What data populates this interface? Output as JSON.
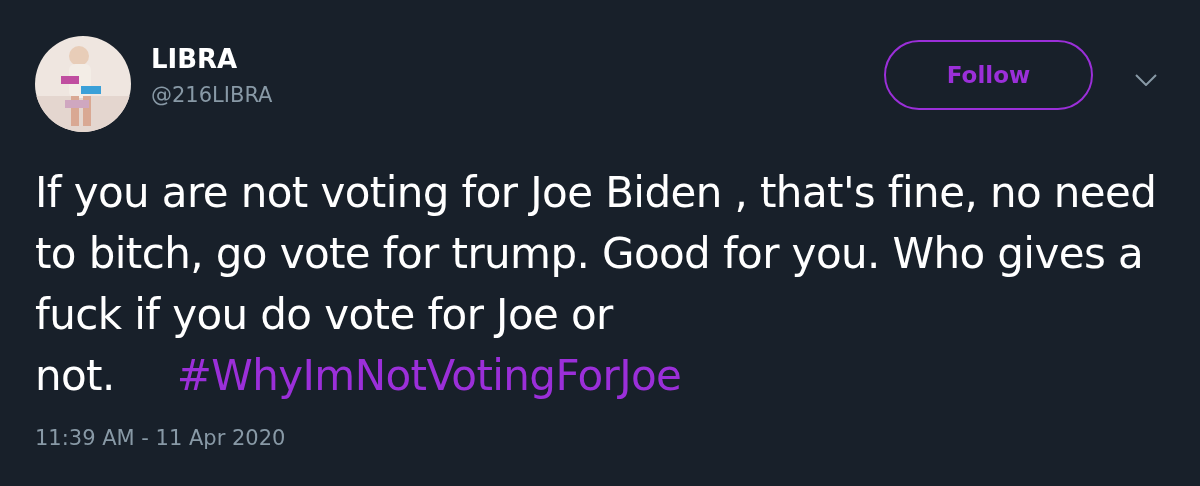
{
  "author": {
    "name": "LIBRA",
    "handle": "@216LIBRA"
  },
  "follow_button": {
    "label": "Follow"
  },
  "tweet": {
    "text": "If you are not voting for Joe Biden , that's fine, no need to bitch, go vote for trump. Good for you. Who gives a fuck if you do vote for Joe or not.",
    "hashtag": "#WhyImNotVotingForJoe"
  },
  "timestamp": "11:39 AM - 11 Apr 2020"
}
